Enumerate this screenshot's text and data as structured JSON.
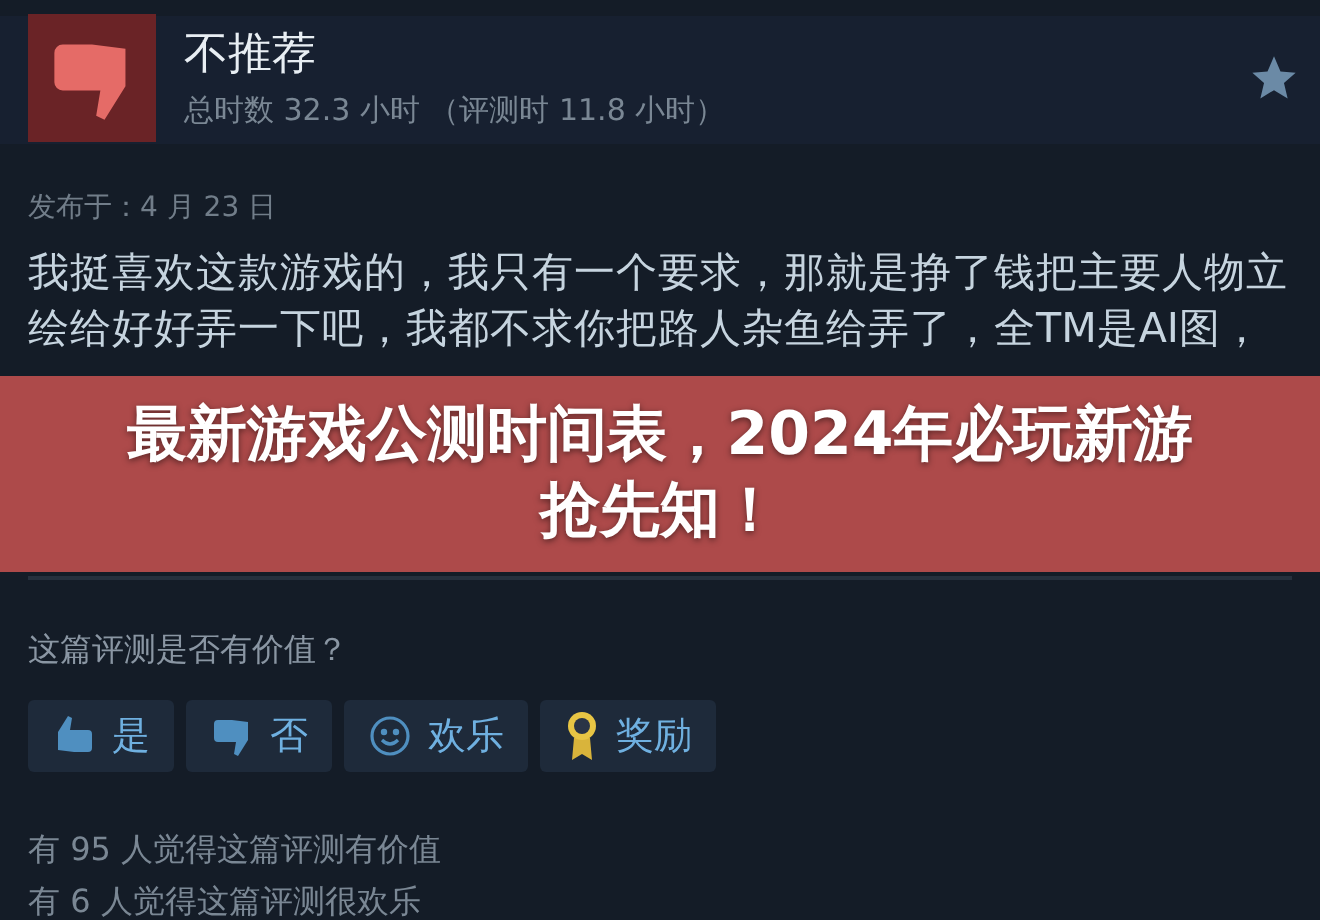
{
  "review": {
    "verdict": "不推荐",
    "playtime": "总时数 32.3 小时 （评测时 11.8 小时）",
    "posted": "发布于：4 月 23 日",
    "text": "我挺喜欢这款游戏的，我只有一个要求，那就是挣了钱把主要人物立绘给好好弄一下吧，我都不求你把路人杂鱼给弄了，全TM是AI图，"
  },
  "overlay_title": "最新游戏公测时间表，2024年必玩新游抢先知！",
  "helpful_prompt": "这篇评测是否有价值？",
  "vote_buttons": [
    {
      "kind": "yes",
      "label": "是"
    },
    {
      "kind": "no",
      "label": "否"
    },
    {
      "kind": "funny",
      "label": "欢乐"
    },
    {
      "kind": "award",
      "label": "奖励"
    }
  ],
  "stats": [
    "有 95 人觉得这篇评测有价值",
    "有 6 人觉得这篇评测很欢乐"
  ]
}
